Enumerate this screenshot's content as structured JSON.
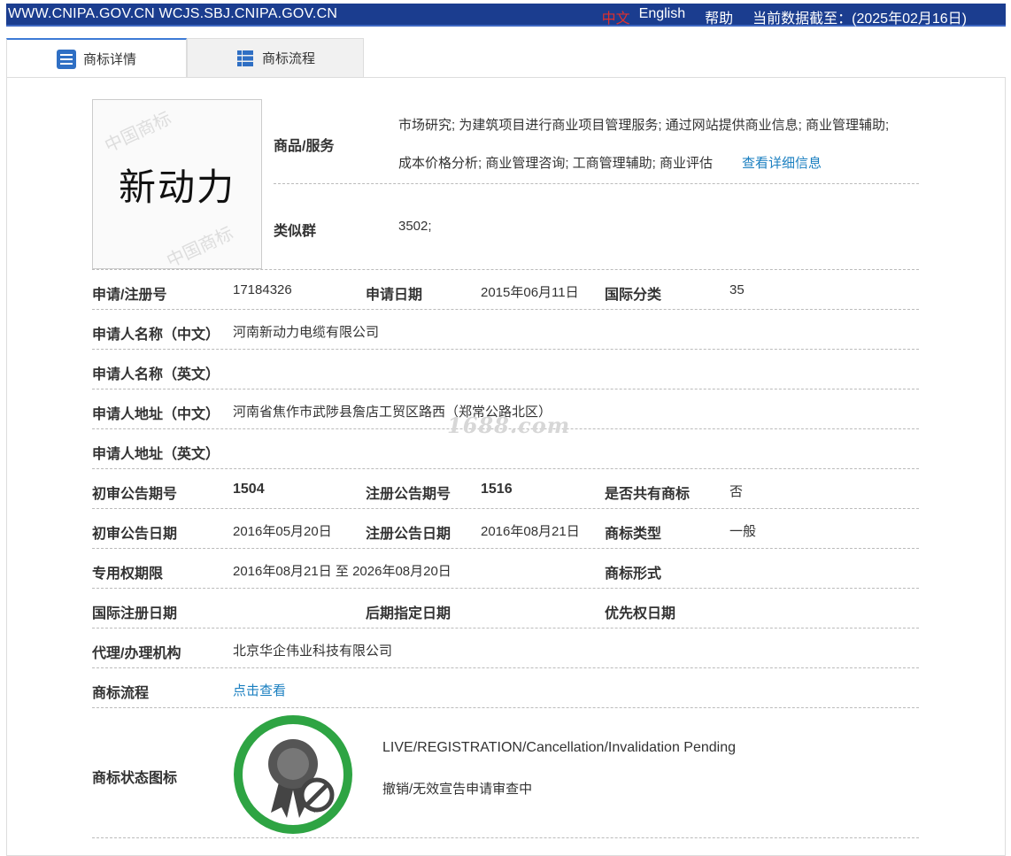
{
  "topbar": {
    "sites": "WWW.CNIPA.GOV.CN WCJS.SBJ.CNIPA.GOV.CN",
    "lang_cn": "中文",
    "lang_en": "English",
    "help": "帮助",
    "data_date": "当前数据截至：(2025年02月16日)"
  },
  "tabs": [
    {
      "label": "商标详情",
      "icon": "list-detail-icon"
    },
    {
      "label": "商标流程",
      "icon": "grid-list-icon"
    }
  ],
  "logo": {
    "text": "新动力",
    "stamp": "中国商标"
  },
  "goods": {
    "label": "商品/服务",
    "line1": "市场研究; 为建筑项目进行商业项目管理服务; 通过网站提供商业信息; 商业管理辅助;",
    "line2": "成本价格分析; 商业管理咨询; 工商管理辅助; 商业评估",
    "more_link": "查看详细信息"
  },
  "similar_group": {
    "label": "类似群",
    "value": "3502;"
  },
  "rows": {
    "reg_no_label": "申请/注册号",
    "reg_no": "17184326",
    "app_date_label": "申请日期",
    "app_date": "2015年06月11日",
    "intl_class_label": "国际分类",
    "intl_class": "35",
    "applicant_cn_label": "申请人名称（中文）",
    "applicant_cn": "河南新动力电缆有限公司",
    "applicant_en_label": "申请人名称（英文）",
    "address_cn_label": "申请人地址（中文）",
    "address_cn": "河南省焦作市武陟县詹店工贸区路西（郑常公路北区）",
    "address_en_label": "申请人地址（英文）",
    "prelim_no_label": "初审公告期号",
    "prelim_no": "1504",
    "reg_pub_no_label": "注册公告期号",
    "reg_pub_no": "1516",
    "shared_label": "是否共有商标",
    "shared": "否",
    "prelim_date_label": "初审公告日期",
    "prelim_date": "2016年05月20日",
    "reg_pub_date_label": "注册公告日期",
    "reg_pub_date": "2016年08月21日",
    "tm_type_label": "商标类型",
    "tm_type": "一般",
    "exclusive_label": "专用权期限",
    "exclusive": "2016年08月21日 至 2026年08月20日",
    "tm_form_label": "商标形式",
    "intl_reg_date_label": "国际注册日期",
    "later_date_label": "后期指定日期",
    "priority_date_label": "优先权日期",
    "agent_label": "代理/办理机构",
    "agent": "北京华企伟业科技有限公司",
    "process_label": "商标流程",
    "process_link": "点击查看",
    "status_icon_label": "商标状态图标"
  },
  "status": {
    "en": "LIVE/REGISTRATION/Cancellation/Invalidation Pending",
    "cn": "撤销/无效宣告申请审查中",
    "icon": "award-ribbon-prohibited-icon",
    "color": "#2ea443"
  },
  "watermark": "1688.com",
  "colors": {
    "topbar": "#1b3d8f",
    "link": "#1a7fc0",
    "lang_cn": "#e0302c"
  }
}
